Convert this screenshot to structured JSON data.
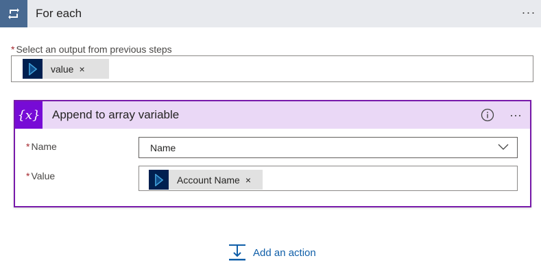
{
  "foreach": {
    "title": "For each",
    "more_label": "···",
    "output_label": "Select an output from previous steps",
    "required_mark": "*",
    "token": {
      "label": "value",
      "remove": "×"
    }
  },
  "append": {
    "title": "Append to array variable",
    "icon_label": "{x}",
    "more_label": "···",
    "name_label": "Name",
    "name_value": "Name",
    "value_label": "Value",
    "required_mark": "*",
    "value_token": {
      "label": "Account Name",
      "remove": "×"
    }
  },
  "add_action": {
    "label": "Add an action"
  },
  "colors": {
    "foreach_accent": "#486991",
    "append_accent": "#770bd6",
    "append_header_bg": "#ead8f6",
    "dynamics_token_icon": "#002050",
    "link": "#0f5ea8"
  },
  "icons": [
    "loop-icon",
    "dynamics-icon",
    "variable-icon",
    "info-icon",
    "chevron-down-icon",
    "add-action-icon"
  ]
}
